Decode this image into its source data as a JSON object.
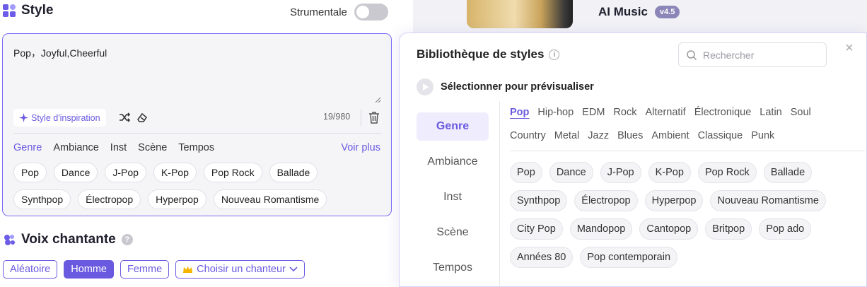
{
  "style": {
    "title": "Style",
    "instrumental_label": "Strumentale",
    "instrumental_on": false,
    "text": "Pop，Joyful,Cheerful",
    "inspiration_label": "Style d'inspiration",
    "counter": "19/980",
    "categories": [
      "Genre",
      "Ambiance",
      "Inst",
      "Scène",
      "Tempos"
    ],
    "voir_plus": "Voir plus",
    "chips_row1": [
      "Pop",
      "Dance",
      "J-Pop",
      "K-Pop",
      "Pop Rock",
      "Ballade"
    ],
    "chips_row2": [
      "Synthpop",
      "Électropop",
      "Hyperpop",
      "Nouveau Romantisme"
    ]
  },
  "voice": {
    "title": "Voix chantante",
    "help": "?",
    "options": [
      "Aléatoire",
      "Homme",
      "Femme"
    ],
    "selected": "Homme",
    "singer_label": "Choisir un chanteur"
  },
  "app": {
    "title": "AI Music",
    "version": "v4.5"
  },
  "library": {
    "title": "Bibliothèque de styles",
    "info": "i",
    "search_placeholder": "Rechercher",
    "close": "×",
    "preview_label": "Sélectionner pour prévisualiser",
    "sidebar": [
      "Genre",
      "Ambiance",
      "Inst",
      "Scène",
      "Tempos"
    ],
    "active_sidebar": "Genre",
    "tabs_row1": [
      "Pop",
      "Hip-hop",
      "EDM",
      "Rock",
      "Alternatif",
      "Électronique",
      "Latin",
      "Soul"
    ],
    "tabs_row2": [
      "Country",
      "Metal",
      "Jazz",
      "Blues",
      "Ambient",
      "Classique",
      "Punk"
    ],
    "active_tab": "Pop",
    "chips_row1": [
      "Pop",
      "Dance",
      "J-Pop",
      "K-Pop",
      "Pop Rock",
      "Ballade"
    ],
    "chips_row2": [
      "Synthpop",
      "Électropop",
      "Hyperpop",
      "Nouveau Romantisme"
    ],
    "chips_row3": [
      "City Pop",
      "Mandopop",
      "Cantopop",
      "Britpop",
      "Pop ado"
    ],
    "chips_row4": [
      "Années 80",
      "Pop contemporain"
    ]
  },
  "colors": {
    "accent": "#6a5ae0",
    "border_accent": "#7b6cf6"
  }
}
